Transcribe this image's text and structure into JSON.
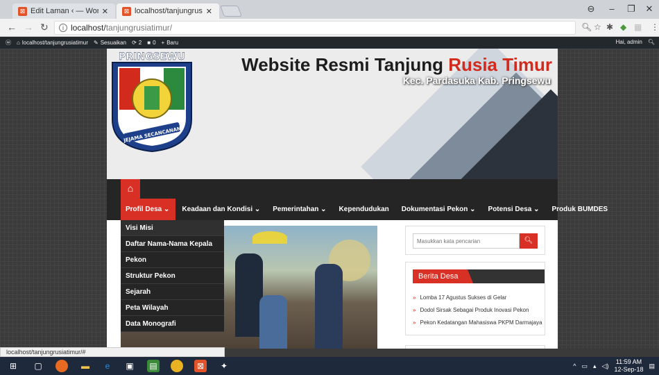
{
  "browser": {
    "tabs": [
      {
        "title": "Edit Laman ‹ — WordPre",
        "active": false
      },
      {
        "title": "localhost/tanjungrusiati",
        "active": true
      }
    ],
    "url_host": "localhost/",
    "url_path": "tanjungrusiatimur/",
    "status_url": "localhost/tanjungrusiatimur/#"
  },
  "wp_admin": {
    "site": "localhost/tanjungrusiatimur",
    "customize": "Sesuaikan",
    "updates": "2",
    "comments": "0",
    "new": "Baru",
    "greeting": "Hai, admin"
  },
  "header": {
    "logo_text": "PRINGSEWU",
    "logo_motto": "JEJAMA SECANCANAN",
    "title_main": "Website Resmi Tanjung ",
    "title_accent": "Rusia Timur",
    "subtitle": "Kec. Pardasuka Kab. Pringsewu"
  },
  "menu": {
    "items": [
      {
        "label": "Profil Desa ⌄",
        "active": true
      },
      {
        "label": "Keadaan dan Kondisi ⌄"
      },
      {
        "label": "Pemerintahan ⌄"
      },
      {
        "label": "Kependudukan"
      },
      {
        "label": "Dokumentasi Pekon ⌄"
      },
      {
        "label": "Potensi Desa ⌄"
      },
      {
        "label": "Produk BUMDES"
      }
    ],
    "dropdown": [
      "Visi Misi",
      "Daftar Nama-Nama Kepala",
      "Pekon",
      "Struktur Pekon",
      "Sejarah",
      "Peta Wilayah",
      "Data Monografi"
    ]
  },
  "sidebar": {
    "search_placeholder": "Masukkan kata pencarian",
    "widget_title": "Berita Desa",
    "news": [
      "Lomba 17 Agustus Sukses di Gelar",
      "Dodol Sirsak Sebagai Produk Inovasi Pekon",
      "Pekon Kedatangan Mahasiswa PKPM Darmajaya"
    ]
  },
  "taskbar": {
    "time": "11:59 AM",
    "date": "12-Sep-18"
  },
  "colors": {
    "accent": "#d93025",
    "menu_bg": "#252525",
    "wp_bar": "#23282d"
  }
}
